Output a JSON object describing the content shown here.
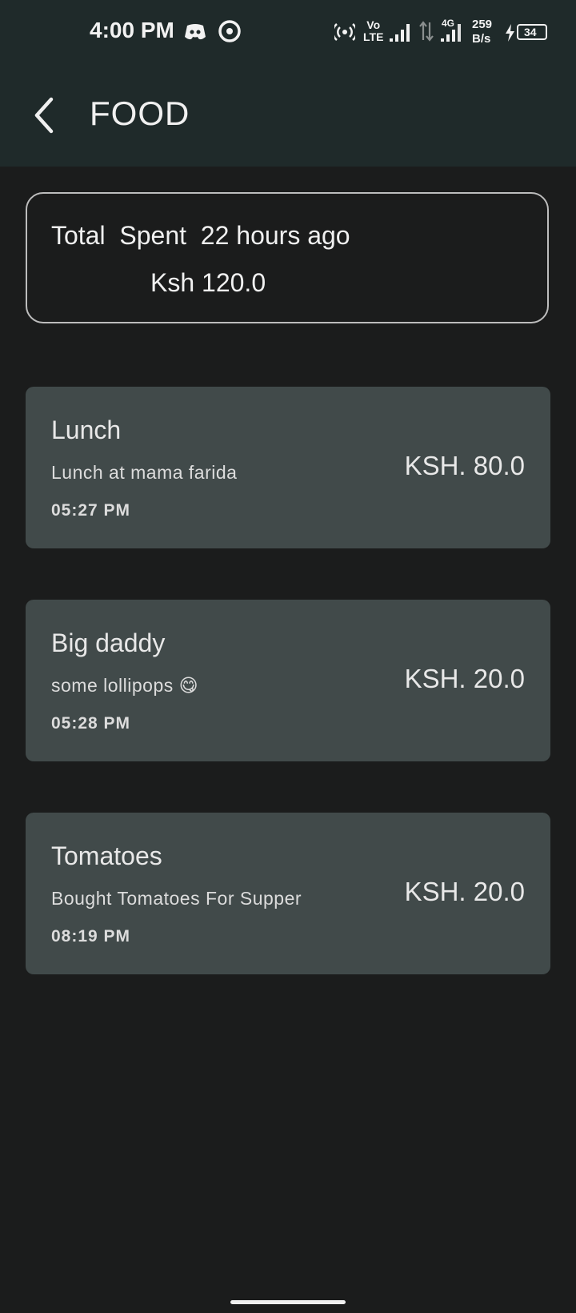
{
  "status_bar": {
    "time": "4:00 PM",
    "volte": "Vo\nLTE",
    "network_type": "4G",
    "data_speed_value": "259",
    "data_speed_unit": "B/s",
    "battery": "34",
    "icons": [
      "discord-icon",
      "sync-icon",
      "hotspot-icon",
      "signal-icon",
      "data-arrows-icon",
      "signal-icon",
      "charging-icon",
      "battery-icon"
    ]
  },
  "app_bar": {
    "back_icon": "chevron-left-icon",
    "title": "FOOD"
  },
  "summary": {
    "line1": "Total  Spent  22 hours ago",
    "amount": "Ksh 120.0"
  },
  "expenses": [
    {
      "title": "Lunch",
      "description": "Lunch at mama farida",
      "time": "05:27 PM",
      "amount": "KSH. 80.0"
    },
    {
      "title": "Big daddy",
      "description": "some lollipops 😋",
      "time": "05:28 PM",
      "amount": "KSH. 20.0"
    },
    {
      "title": "Tomatoes",
      "description": "Bought Tomatoes For Supper",
      "time": "08:19 PM",
      "amount": "KSH. 20.0"
    }
  ],
  "colors": {
    "background": "#1b1c1c",
    "top_bar": "#1f2a2a",
    "card": "#414a4a",
    "text": "#e8e8e8"
  }
}
